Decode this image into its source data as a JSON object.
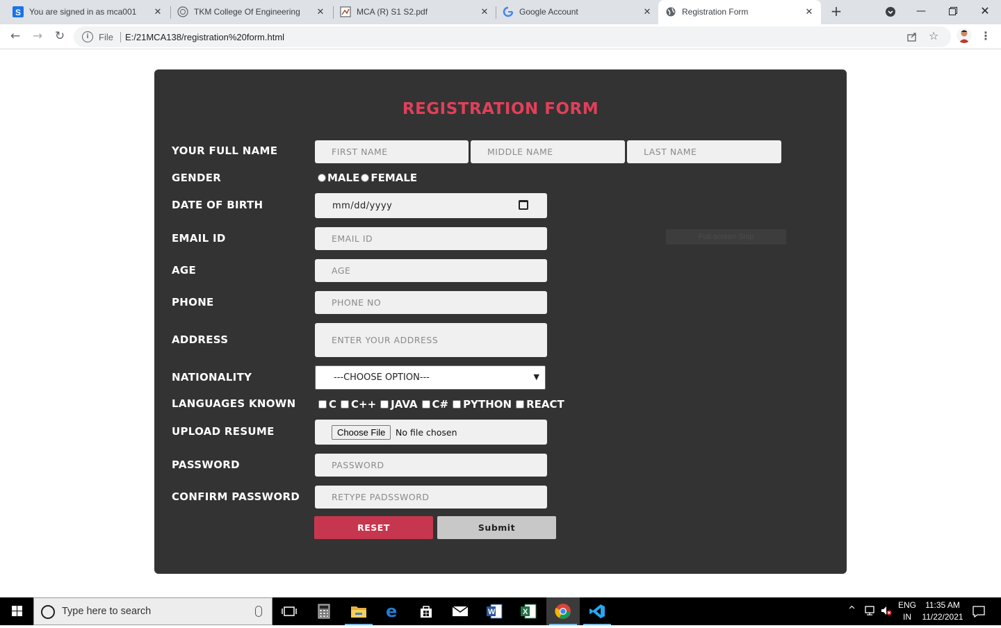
{
  "browser": {
    "tabs": [
      {
        "title": "You are signed in as mca001",
        "icon": "s-app-icon"
      },
      {
        "title": "TKM College Of Engineering",
        "icon": "college-globe-icon"
      },
      {
        "title": "MCA (R) S1 S2.pdf",
        "icon": "pdf-icon"
      },
      {
        "title": "Google Account",
        "icon": "google-g-icon"
      },
      {
        "title": "Registration Form",
        "icon": "globe-icon",
        "active": true
      }
    ],
    "address": {
      "scheme_label": "File",
      "url": "E:/21MCA138/registration%20form.html"
    }
  },
  "form": {
    "title": "REGISTRATION FORM",
    "labels": {
      "full_name": "YOUR FULL NAME",
      "gender": "GENDER",
      "dob": "DATE OF BIRTH",
      "email": "EMAIL ID",
      "age": "AGE",
      "phone": "PHONE",
      "address": "ADDRESS",
      "nationality": "NATIONALITY",
      "languages": "LANGUAGES KNOWN",
      "resume": "UPLOAD RESUME",
      "password": "PASSWORD",
      "confirm_password": "CONFIRM PASSWORD"
    },
    "placeholders": {
      "first_name": "FIRST NAME",
      "middle_name": "MIDDLE NAME",
      "last_name": "LAST NAME",
      "email": "EMAIL ID",
      "age": "AGE",
      "phone": "PHONE NO",
      "address": "ENTER YOUR ADDRESS",
      "password": "PASSWORD",
      "confirm_password": "RETYPE PADSSWORD"
    },
    "gender_options": [
      "MALE",
      "FEMALE"
    ],
    "dob_value": "mm/dd/yyyy",
    "nationality_selected": "---CHOOSE OPTION---",
    "languages": [
      "C",
      "C++",
      "JAVA",
      "C#",
      "PYTHON",
      "REACT"
    ],
    "resume": {
      "button": "Choose File",
      "status": "No file chosen"
    },
    "buttons": {
      "reset": "RESET",
      "submit": "Submit"
    },
    "colors": {
      "card_bg": "#333333",
      "title": "#e0405a",
      "reset_bg": "#c7364f",
      "submit_bg": "#c8c8c8"
    }
  },
  "overlay": {
    "snip_label": "Full-screen Snip"
  },
  "taskbar": {
    "search_placeholder": "Type here to search",
    "pinned": [
      "task-view-icon",
      "calculator-icon",
      "file-explorer-icon",
      "edge-icon",
      "store-icon",
      "mail-icon",
      "word-icon",
      "excel-icon",
      "chrome-icon",
      "vscode-icon"
    ],
    "lang_top": "ENG",
    "lang_bottom": "IN",
    "time": "11:35 AM",
    "date": "11/22/2021"
  }
}
